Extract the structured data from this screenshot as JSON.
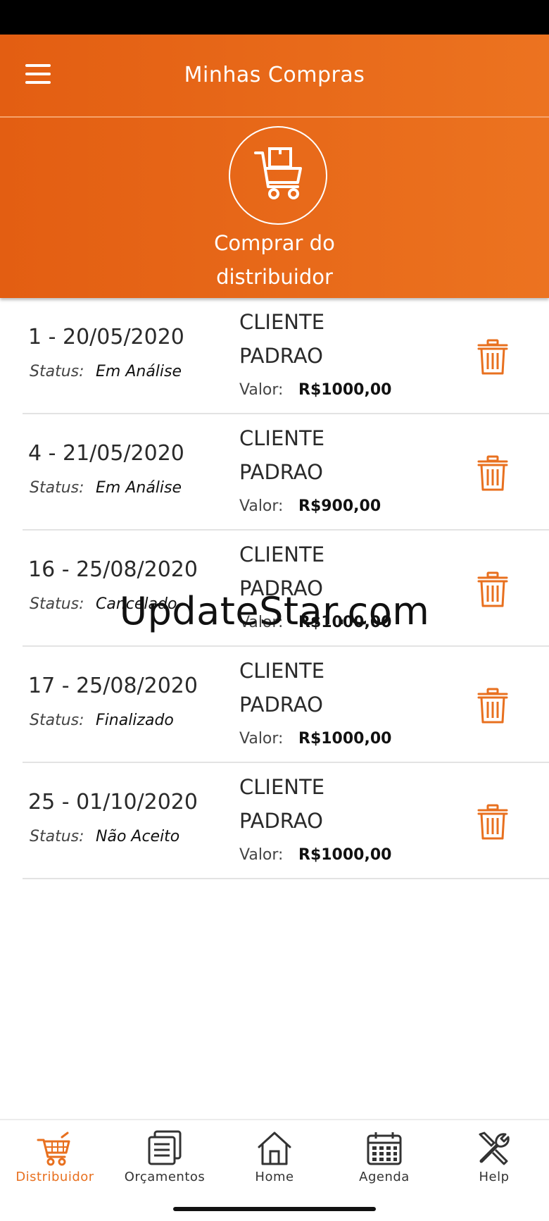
{
  "app": {
    "title": "Minhas Compras",
    "buy_button_label": "Comprar do distribuidor",
    "accent_color": "#e8701f"
  },
  "orders": [
    {
      "id_date": "1 - 20/05/2020",
      "status_label": "Status:",
      "status": "Em Análise",
      "client": "CLIENTE PADRAO",
      "value_label": "Valor:",
      "value": "R$1000,00"
    },
    {
      "id_date": "4 - 21/05/2020",
      "status_label": "Status:",
      "status": "Em Análise",
      "client": "CLIENTE PADRAO",
      "value_label": "Valor:",
      "value": "R$900,00"
    },
    {
      "id_date": "16 - 25/08/2020",
      "status_label": "Status:",
      "status": "Cancelado",
      "client": "CLIENTE PADRAO",
      "value_label": "Valor:",
      "value": "R$1000,00"
    },
    {
      "id_date": "17 - 25/08/2020",
      "status_label": "Status:",
      "status": "Finalizado",
      "client": "CLIENTE PADRAO",
      "value_label": "Valor:",
      "value": "R$1000,00"
    },
    {
      "id_date": "25 - 01/10/2020",
      "status_label": "Status:",
      "status": "Não Aceito",
      "client": "CLIENTE PADRAO",
      "value_label": "Valor:",
      "value": "R$1000,00"
    }
  ],
  "watermark": "UpdateStar.com",
  "bottom_nav": [
    {
      "label": "Distribuidor",
      "icon": "cart-icon",
      "active": true
    },
    {
      "label": "Orçamentos",
      "icon": "documents-icon",
      "active": false
    },
    {
      "label": "Home",
      "icon": "home-icon",
      "active": false
    },
    {
      "label": "Agenda",
      "icon": "calendar-icon",
      "active": false
    },
    {
      "label": "Help",
      "icon": "tools-icon",
      "active": false
    }
  ]
}
